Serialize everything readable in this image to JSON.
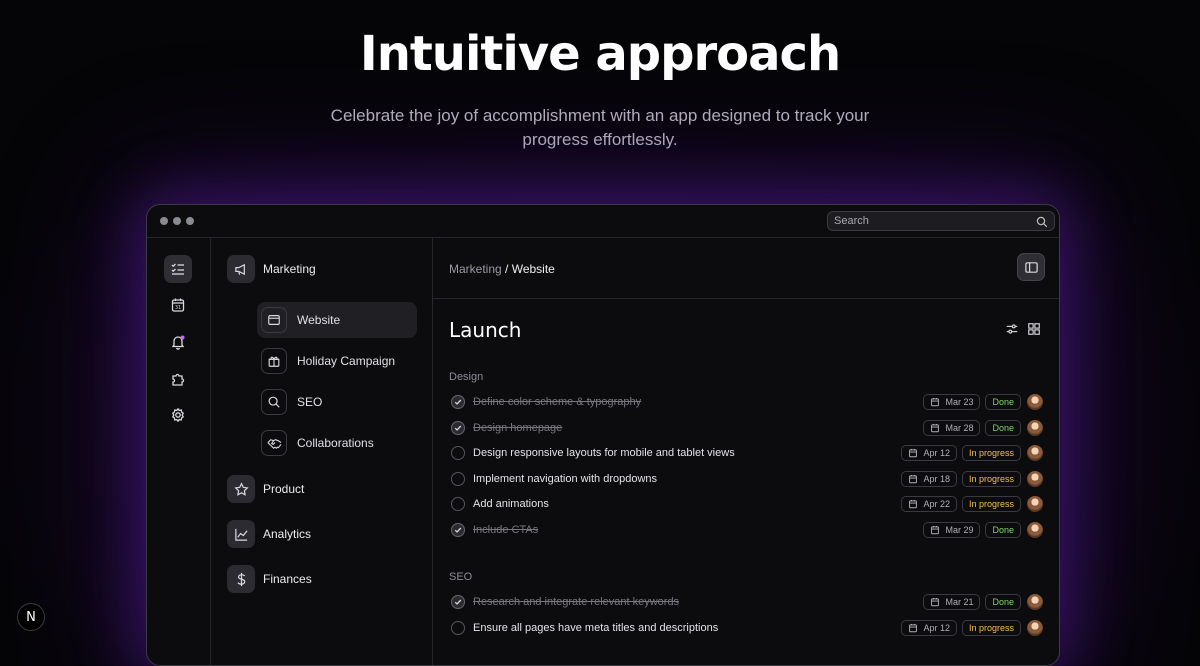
{
  "hero": {
    "title": "Intuitive approach",
    "subtitle": "Celebrate the joy of accomplishment with an app designed to track your progress effortlessly."
  },
  "window": {
    "search_placeholder": "Search"
  },
  "rail": {
    "items": [
      {
        "icon": "checklist-icon",
        "active": true
      },
      {
        "icon": "calendar-icon",
        "active": false
      },
      {
        "icon": "bell-icon",
        "active": false
      },
      {
        "icon": "puzzle-icon",
        "active": false
      },
      {
        "icon": "gear-icon",
        "active": false
      }
    ]
  },
  "sidebar": {
    "groups": [
      {
        "label": "Marketing",
        "icon": "megaphone-icon"
      },
      {
        "label": "Product",
        "icon": "star-icon"
      },
      {
        "label": "Analytics",
        "icon": "chart-icon"
      },
      {
        "label": "Finances",
        "icon": "dollar-icon"
      }
    ],
    "marketing_items": [
      {
        "label": "Website",
        "icon": "browser-icon",
        "active": true
      },
      {
        "label": "Holiday Campaign",
        "icon": "gift-icon",
        "active": false
      },
      {
        "label": "SEO",
        "icon": "search-icon",
        "active": false
      },
      {
        "label": "Collaborations",
        "icon": "handshake-icon",
        "active": false
      }
    ]
  },
  "main": {
    "breadcrumb_parent": "Marketing",
    "breadcrumb_sep": " / ",
    "breadcrumb_current": "Website",
    "title": "Launch",
    "sections": [
      {
        "name": "Design",
        "tasks": [
          {
            "title": "Define color scheme & typography",
            "done": true,
            "date": "Mar 23",
            "status": "Done"
          },
          {
            "title": "Design homepage",
            "done": true,
            "date": "Mar 28",
            "status": "Done"
          },
          {
            "title": "Design responsive layouts for mobile and tablet views",
            "done": false,
            "date": "Apr 12",
            "status": "In progress"
          },
          {
            "title": "Implement navigation with dropdowns",
            "done": false,
            "date": "Apr 18",
            "status": "In progress"
          },
          {
            "title": "Add animations",
            "done": false,
            "date": "Apr 22",
            "status": "In progress"
          },
          {
            "title": "Include CTAs",
            "done": true,
            "date": "Mar 29",
            "status": "Done"
          }
        ]
      },
      {
        "name": "SEO",
        "tasks": [
          {
            "title": "Research and integrate relevant keywords",
            "done": true,
            "date": "Mar 21",
            "status": "Done"
          },
          {
            "title": "Ensure all pages have meta titles and descriptions",
            "done": false,
            "date": "Apr 12",
            "status": "In progress"
          }
        ]
      }
    ]
  },
  "logo": {
    "letter": "N"
  },
  "colors": {
    "done": "#7fd86a",
    "in_progress": "#f2c14b",
    "glow": "#7a28dc"
  }
}
